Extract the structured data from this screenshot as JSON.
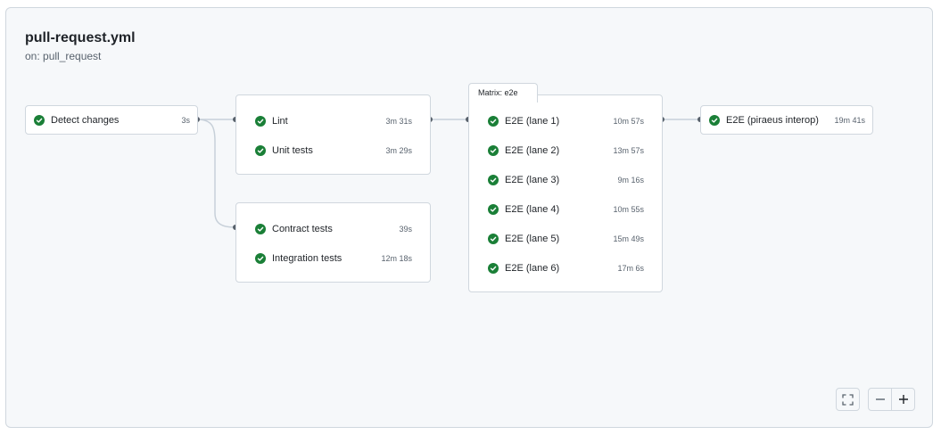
{
  "workflow": {
    "title": "pull-request.yml",
    "trigger": "on: pull_request"
  },
  "jobs": {
    "detect_changes": {
      "name": "Detect changes",
      "duration": "3s"
    },
    "lint": {
      "name": "Lint",
      "duration": "3m 31s"
    },
    "unit_tests": {
      "name": "Unit tests",
      "duration": "3m 29s"
    },
    "contract_tests": {
      "name": "Contract tests",
      "duration": "39s"
    },
    "integration_tests": {
      "name": "Integration tests",
      "duration": "12m 18s"
    },
    "matrix": {
      "label": "Matrix: e2e",
      "lanes": [
        {
          "name": "E2E (lane 1)",
          "duration": "10m 57s"
        },
        {
          "name": "E2E (lane 2)",
          "duration": "13m 57s"
        },
        {
          "name": "E2E (lane 3)",
          "duration": "9m 16s"
        },
        {
          "name": "E2E (lane 4)",
          "duration": "10m 55s"
        },
        {
          "name": "E2E (lane 5)",
          "duration": "15m 49s"
        },
        {
          "name": "E2E (lane 6)",
          "duration": "17m 6s"
        }
      ]
    },
    "piraeus": {
      "name": "E2E (piraeus interop)",
      "duration": "19m 41s"
    }
  },
  "status": {
    "success_color": "#1a7f37",
    "icon": "check-circle-icon"
  },
  "controls": {
    "fullscreen_icon": "fullscreen-icon",
    "zoom_out_icon": "minus-icon",
    "zoom_in_icon": "plus-icon"
  }
}
